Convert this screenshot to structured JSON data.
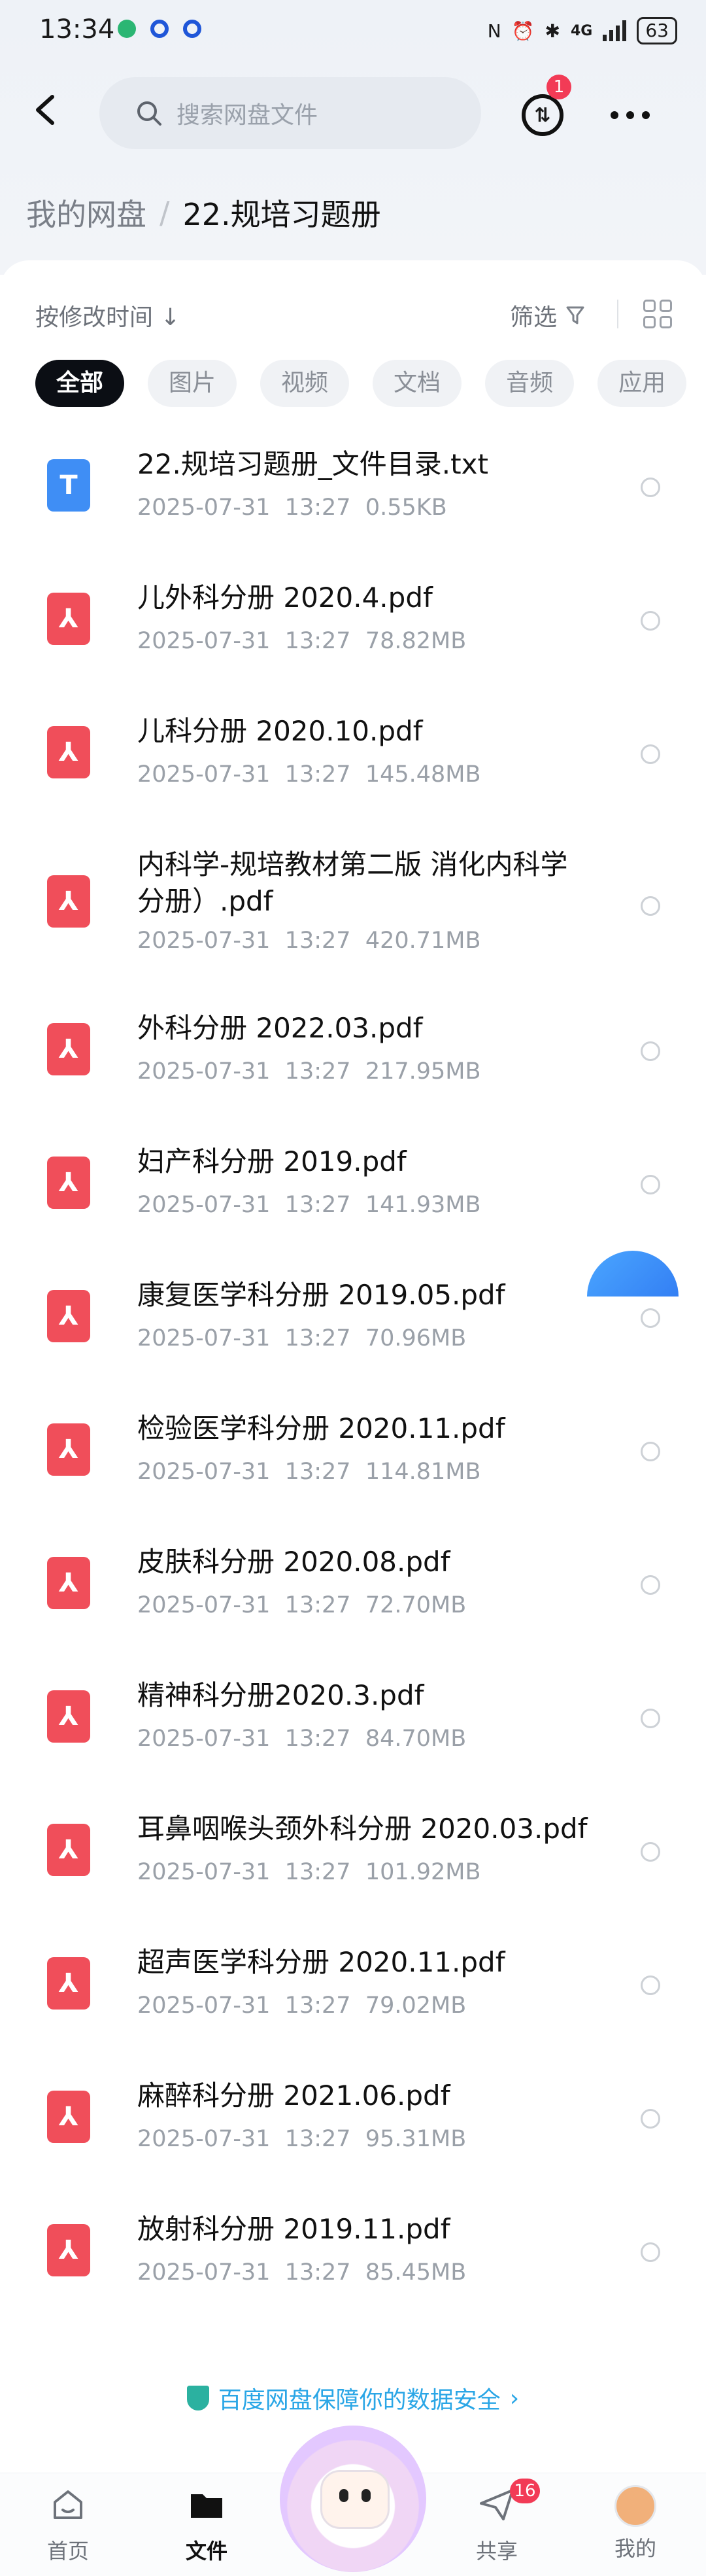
{
  "status_bar": {
    "time": "13:34",
    "network": "4G",
    "battery": "63"
  },
  "header": {
    "search_placeholder": "搜索网盘文件",
    "transfer_badge": "1"
  },
  "breadcrumb": {
    "root": "我的网盘",
    "separator": "/",
    "current": "22.规培习题册"
  },
  "toolbar": {
    "sort_label": "按修改时间",
    "filter_label": "筛选"
  },
  "tabs": [
    {
      "label": "全部",
      "active": true
    },
    {
      "label": "图片"
    },
    {
      "label": "视频"
    },
    {
      "label": "文档"
    },
    {
      "label": "音频"
    },
    {
      "label": "应用"
    }
  ],
  "files": [
    {
      "name": "22.规培习题册_文件目录.txt",
      "date": "2025-07-31",
      "time": "13:27",
      "size": "0.55KB",
      "type": "txt"
    },
    {
      "name": "儿外科分册   2020.4.pdf",
      "date": "2025-07-31",
      "time": "13:27",
      "size": "78.82MB",
      "type": "pdf"
    },
    {
      "name": "儿科分册  2020.10.pdf",
      "date": "2025-07-31",
      "time": "13:27",
      "size": "145.48MB",
      "type": "pdf"
    },
    {
      "name": "内科学-规培教材第二版 消化内科学分册）.pdf",
      "date": "2025-07-31",
      "time": "13:27",
      "size": "420.71MB",
      "type": "pdf"
    },
    {
      "name": "外科分册  2022.03.pdf",
      "date": "2025-07-31",
      "time": "13:27",
      "size": "217.95MB",
      "type": "pdf"
    },
    {
      "name": "妇产科分册  2019.pdf",
      "date": "2025-07-31",
      "time": "13:27",
      "size": "141.93MB",
      "type": "pdf"
    },
    {
      "name": "康复医学科分册  2019.05.pdf",
      "date": "2025-07-31",
      "time": "13:27",
      "size": "70.96MB",
      "type": "pdf"
    },
    {
      "name": "检验医学科分册  2020.11.pdf",
      "date": "2025-07-31",
      "time": "13:27",
      "size": "114.81MB",
      "type": "pdf"
    },
    {
      "name": "皮肤科分册   2020.08.pdf",
      "date": "2025-07-31",
      "time": "13:27",
      "size": "72.70MB",
      "type": "pdf"
    },
    {
      "name": "精神科分册2020.3.pdf",
      "date": "2025-07-31",
      "time": "13:27",
      "size": "84.70MB",
      "type": "pdf"
    },
    {
      "name": "耳鼻咽喉头颈外科分册   2020.03.pdf",
      "date": "2025-07-31",
      "time": "13:27",
      "size": "101.92MB",
      "type": "pdf"
    },
    {
      "name": "超声医学科分册   2020.11.pdf",
      "date": "2025-07-31",
      "time": "13:27",
      "size": "79.02MB",
      "type": "pdf"
    },
    {
      "name": "麻醉科分册 2021.06.pdf",
      "date": "2025-07-31",
      "time": "13:27",
      "size": "95.31MB",
      "type": "pdf"
    },
    {
      "name": "放射科分册   2019.11.pdf",
      "date": "2025-07-31",
      "time": "13:27",
      "size": "85.45MB",
      "type": "pdf"
    }
  ],
  "safety_banner": "百度网盘保障你的数据安全",
  "bottom_nav": {
    "home": "首页",
    "files": "文件",
    "share": "共享",
    "share_badge": "16",
    "mine": "我的"
  },
  "colors": {
    "accent": "#2c72f0",
    "pdf": "#f04e5a",
    "txt": "#3f8ef5",
    "badge": "#f23b56"
  }
}
